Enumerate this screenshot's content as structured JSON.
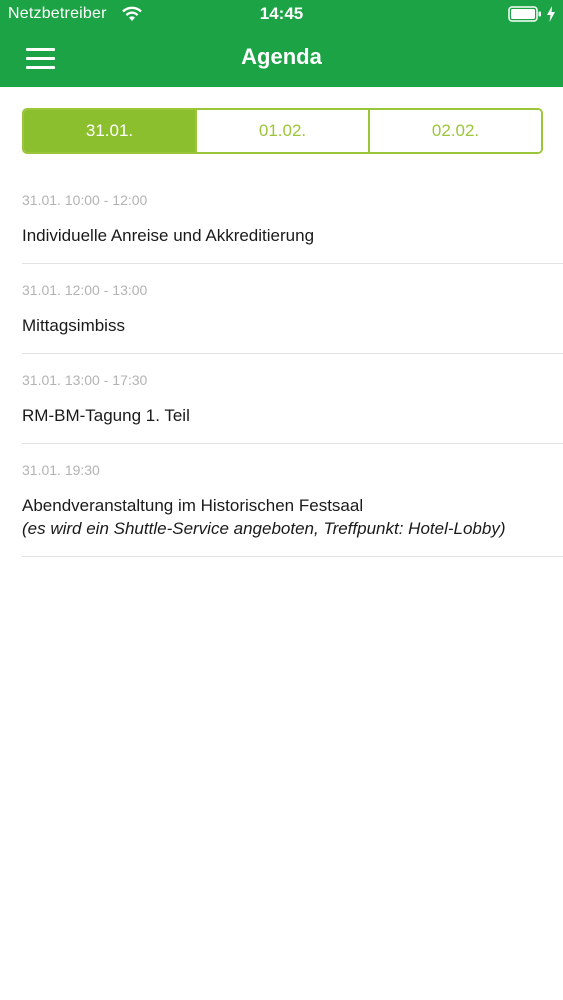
{
  "status_bar": {
    "carrier": "Netzbetreiber",
    "time": "14:45",
    "wifi_icon": "wifi-icon",
    "battery_icon": "battery-full-icon",
    "charging_icon": "charging-bolt-icon"
  },
  "nav": {
    "title": "Agenda",
    "menu_icon": "hamburger-menu-icon"
  },
  "colors": {
    "header_green": "#1ba345",
    "segment_accent": "#9cc63a",
    "segment_active_bg": "#8cbf2e",
    "time_text": "#b3b3b3"
  },
  "days": [
    {
      "label": "31.01.",
      "active": true
    },
    {
      "label": "01.02.",
      "active": false
    },
    {
      "label": "02.02.",
      "active": false
    }
  ],
  "agenda": [
    {
      "time": "31.01. 10:00 - 12:00",
      "title": "Individuelle Anreise und Akkreditierung",
      "note": ""
    },
    {
      "time": "31.01. 12:00 - 13:00",
      "title": "Mittagsimbiss",
      "note": ""
    },
    {
      "time": "31.01. 13:00 - 17:30",
      "title": "RM-BM-Tagung 1. Teil",
      "note": ""
    },
    {
      "time": "31.01. 19:30",
      "title": "Abendveranstaltung im Historischen Festsaal",
      "note": "(es wird ein Shuttle-Service angeboten, Treffpunkt: Hotel-Lobby)"
    }
  ]
}
